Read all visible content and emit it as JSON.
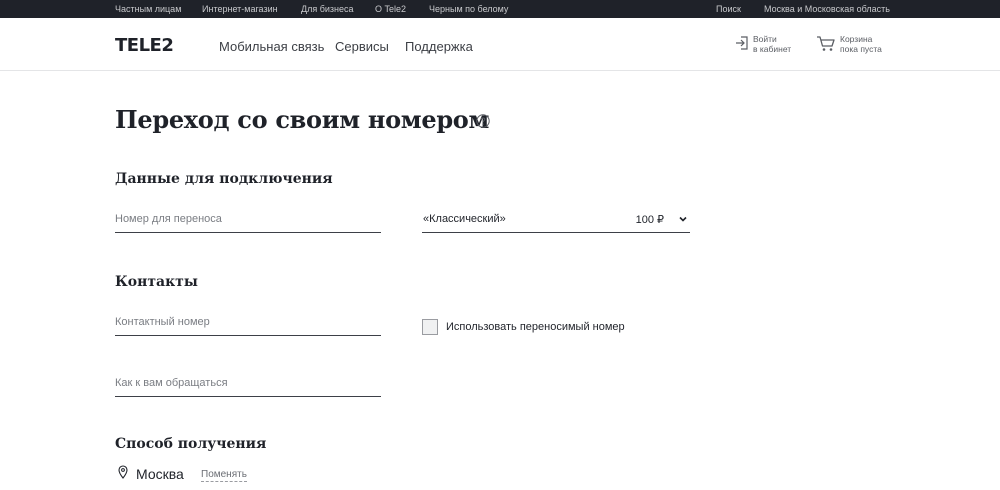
{
  "topbar": {
    "links": [
      "Частным лицам",
      "Интернет-магазин",
      "Для бизнеса",
      "О Tele2",
      "Черным по белому"
    ],
    "search": "Поиск",
    "region": "Москва и Московская область"
  },
  "header": {
    "logo": "TELE2",
    "nav": [
      "Мобильная связь",
      "Сервисы",
      "Поддержка"
    ],
    "login": {
      "line1": "Войти",
      "line2": "в кабинет",
      "icon": "login-icon"
    },
    "cart": {
      "line1": "Корзина",
      "line2": "пока пуста",
      "icon": "cart-icon"
    }
  },
  "main": {
    "title": "Переход со своим номером",
    "help_icon": "question-circle-icon",
    "connection": {
      "title": "Данные для подключения",
      "number_placeholder": "Номер для переноса",
      "tariff_selected": "«Классический»",
      "tariff_price": "100 ₽"
    },
    "contacts": {
      "title": "Контакты",
      "phone_placeholder": "Контактный номер",
      "use_ported_label": "Использовать переносимый номер",
      "use_ported_checked": false,
      "name_placeholder": "Как к вам обращаться"
    },
    "delivery": {
      "title": "Способ получения",
      "city": "Москва",
      "change_link": "Поменять"
    }
  }
}
